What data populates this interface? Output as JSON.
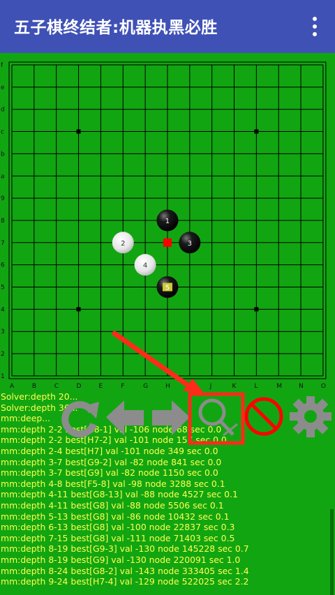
{
  "app": {
    "title": "五子棋终结者:机器执黑必胜",
    "menu_icon": "more-vert-icon"
  },
  "board": {
    "size": 15,
    "col_labels": [
      "A",
      "B",
      "C",
      "D",
      "E",
      "F",
      "G",
      "H",
      "I",
      "J",
      "K",
      "L",
      "M",
      "N",
      "O"
    ],
    "row_labels": [
      "f",
      "e",
      "d",
      "c",
      "b",
      "a",
      "9",
      "8",
      "7",
      "6",
      "5",
      "4",
      "3",
      "2",
      "1"
    ],
    "star_points": [
      [
        "D",
        "c"
      ],
      [
        "L",
        "c"
      ],
      [
        "D",
        "4"
      ],
      [
        "L",
        "4"
      ]
    ],
    "stones": [
      {
        "col": "H",
        "row": "8",
        "color": "black",
        "number": "1"
      },
      {
        "col": "F",
        "row": "7",
        "color": "white",
        "number": "2"
      },
      {
        "col": "I",
        "row": "7",
        "color": "black",
        "number": "3"
      },
      {
        "col": "G",
        "row": "6",
        "color": "white",
        "number": "4"
      },
      {
        "col": "H",
        "row": "5",
        "color": "black",
        "number": "5",
        "last": true
      }
    ],
    "hint_marker": {
      "col": "H",
      "row": "7",
      "color": "#ff0000"
    },
    "colors": {
      "board_bg": "#00aa00",
      "line": "#000000",
      "label": "#111111"
    }
  },
  "toolbar": [
    {
      "name": "restart-button",
      "icon": "refresh-icon"
    },
    {
      "name": "undo-button",
      "icon": "arrow-left-icon"
    },
    {
      "name": "redo-button",
      "icon": "arrow-right-icon"
    },
    {
      "name": "hint-search-button",
      "icon": "search-hint-icon",
      "highlighted": true
    },
    {
      "name": "stop-button",
      "icon": "no-entry-icon"
    },
    {
      "name": "settings-button",
      "icon": "gear-icon"
    }
  ],
  "log": [
    "Solver:depth 20...",
    "Solver:depth 36...",
    "mm:deep...",
    "mm:depth 2-2 best[G8-1] val -106 node 68 sec 0.0",
    "mm:depth 2-2 best[H7-2] val -101 node 157 sec 0.0",
    "mm:depth 2-4 best[H7] val -101 node 349 sec 0.0",
    "mm:depth 3-7 best[G9-2] val -82 node 841 sec 0.0",
    "mm:depth 3-7 best[G9] val -82 node 1150 sec 0.0",
    "mm:depth 4-8 best[F5-8] val -98 node 3288 sec 0.1",
    "mm:depth 4-11 best[G8-13] val -88 node 4527 sec 0.1",
    "mm:depth 4-11 best[G8] val -88 node 5506 sec 0.1",
    "mm:depth 5-13 best[G8] val -86 node 10432 sec 0.1",
    "mm:depth 6-13 best[G8] val -100 node 22837 sec 0.3",
    "mm:depth 7-15 best[G8] val -111 node 71403 sec 0.5",
    "mm:depth 8-19 best[G9-3] val -130 node 145228 sec 0.7",
    "mm:depth 8-19 best[G9] val -130 node 220091 sec 1.0",
    "mm:depth 8-24 best[G8-2] val -143 node 333405 sec 1.4",
    "mm:depth 9-24 best[H7-4] val -129 node 522025 sec 2.2"
  ],
  "annotation": {
    "color": "#ff2a1a"
  }
}
